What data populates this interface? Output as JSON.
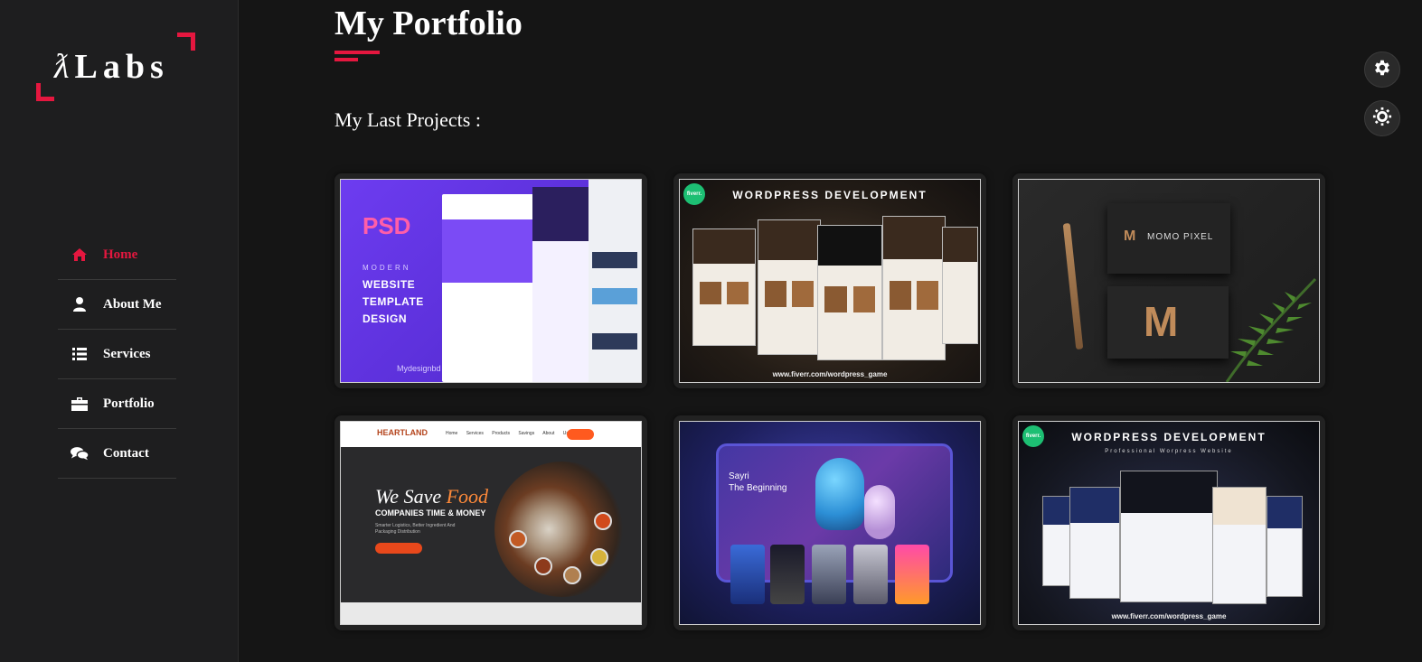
{
  "logo": {
    "mark": "ƛ",
    "text": "Labs"
  },
  "nav": {
    "items": [
      {
        "label": "Home",
        "icon": "home-icon",
        "active": true
      },
      {
        "label": "About Me",
        "icon": "user-icon",
        "active": false
      },
      {
        "label": "Services",
        "icon": "list-icon",
        "active": false
      },
      {
        "label": "Portfolio",
        "icon": "briefcase-icon",
        "active": false
      },
      {
        "label": "Contact",
        "icon": "chat-icon",
        "active": false
      }
    ]
  },
  "page": {
    "title": "My Portfolio",
    "subtitle": "My Last Projects :"
  },
  "projects": [
    {
      "name": "psd-website-template",
      "heading": "PSD",
      "line_small": "MODERN",
      "line1": "WEBSITE",
      "line2": "TEMPLATE",
      "line3": "DESIGN",
      "brand": "Mydesignbd"
    },
    {
      "name": "wordpress-development",
      "badge": "fiverr.",
      "heading": "WORDPRESS DEVELOPMENT",
      "url": "www.fiverr.com/wordpress_game"
    },
    {
      "name": "momo-pixel",
      "mark": "M",
      "heading": "MOMO PIXEL"
    },
    {
      "name": "heartland-supply",
      "logo": "HEARTLAND",
      "menu": "Home Services Products Savings About Us Contact",
      "headline_a": "We Save ",
      "headline_b": "Food",
      "subline": "COMPANIES TIME & MONEY",
      "small": "Smarter Logistics, Better Ingredient And Packaging Distribution"
    },
    {
      "name": "game-ui",
      "title_line1": "Sayri",
      "title_line2": "The Beginning"
    },
    {
      "name": "wordpress-development-2",
      "badge": "fiverr.",
      "heading": "WORDPRESS DEVELOPMENT",
      "sub": "Professional Worpress Website",
      "url": "www.fiverr.com/wordpress_game"
    }
  ],
  "colors": {
    "accent": "#e5173f",
    "background": "#151515",
    "sidebar": "#1e1e1f"
  },
  "controls": {
    "settings_icon": "gear-icon",
    "theme_icon": "sun-icon"
  }
}
